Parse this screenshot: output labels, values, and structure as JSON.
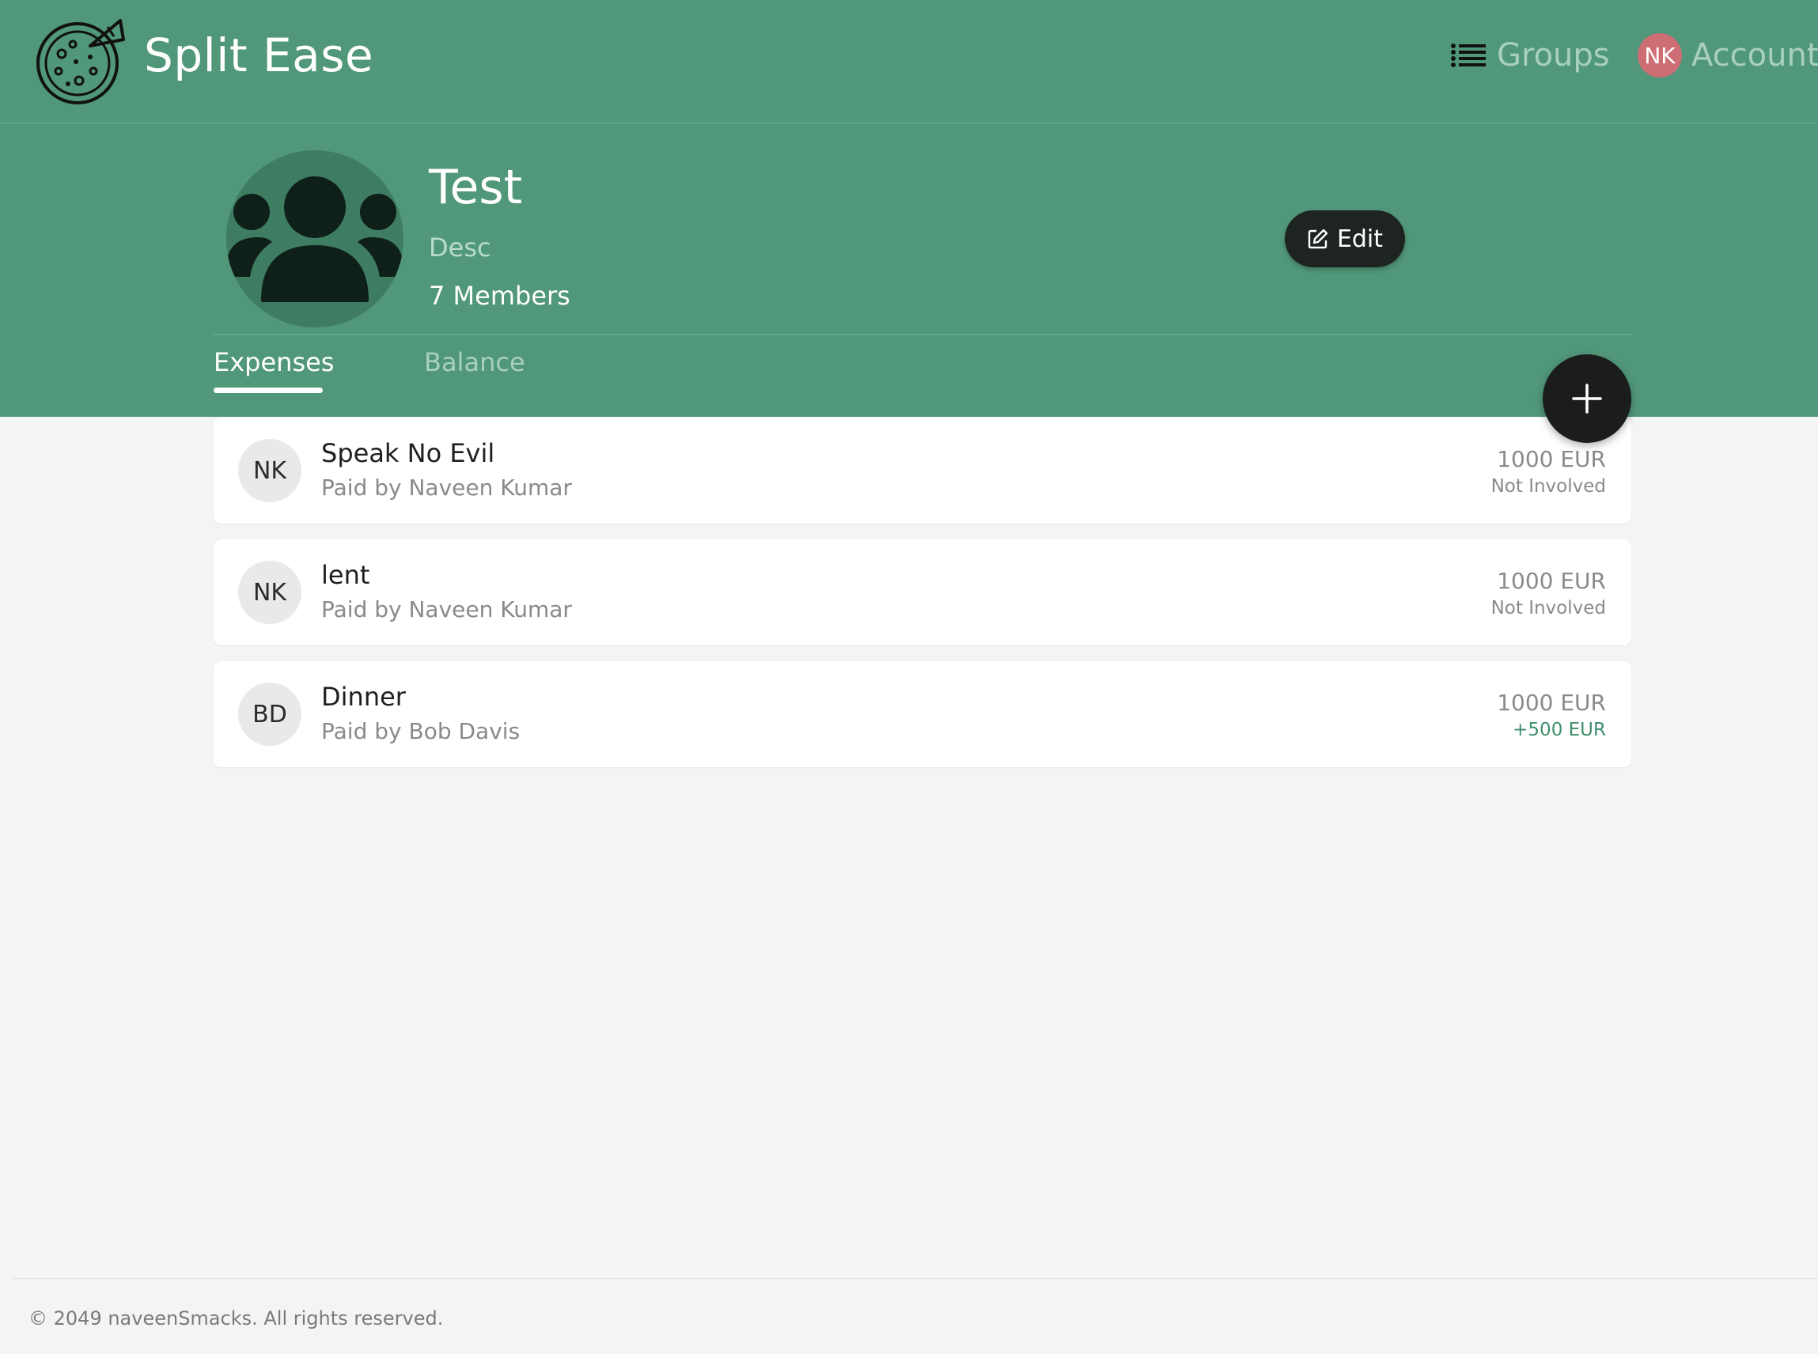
{
  "app": {
    "title": "Split Ease",
    "logo_icon": "pizza-icon"
  },
  "nav": {
    "groups_label": "Groups",
    "account_label": "Account",
    "account_initials": "NK"
  },
  "group": {
    "name": "Test",
    "description": "Desc",
    "members": "7 Members",
    "edit_label": "Edit"
  },
  "tabs": {
    "expenses": "Expenses",
    "balance": "Balance"
  },
  "expenses": [
    {
      "initials": "NK",
      "title": "Speak No Evil",
      "payer": "Paid by Naveen Kumar",
      "amount": "1000 EUR",
      "status": "Not Involved"
    },
    {
      "initials": "NK",
      "title": "lent",
      "payer": "Paid by Naveen Kumar",
      "amount": "1000 EUR",
      "status": "Not Involved"
    },
    {
      "initials": "BD",
      "title": "Dinner",
      "payer": "Paid by Bob Davis",
      "amount": "1000 EUR",
      "status": "+500 EUR"
    }
  ],
  "footer": {
    "text": "© 2049 naveenSmacks. All rights reserved."
  },
  "colors": {
    "primary": "#51977a",
    "dark": "#1d2421",
    "positive": "#3f8f6b",
    "avatar_account": "#cd6e74"
  }
}
